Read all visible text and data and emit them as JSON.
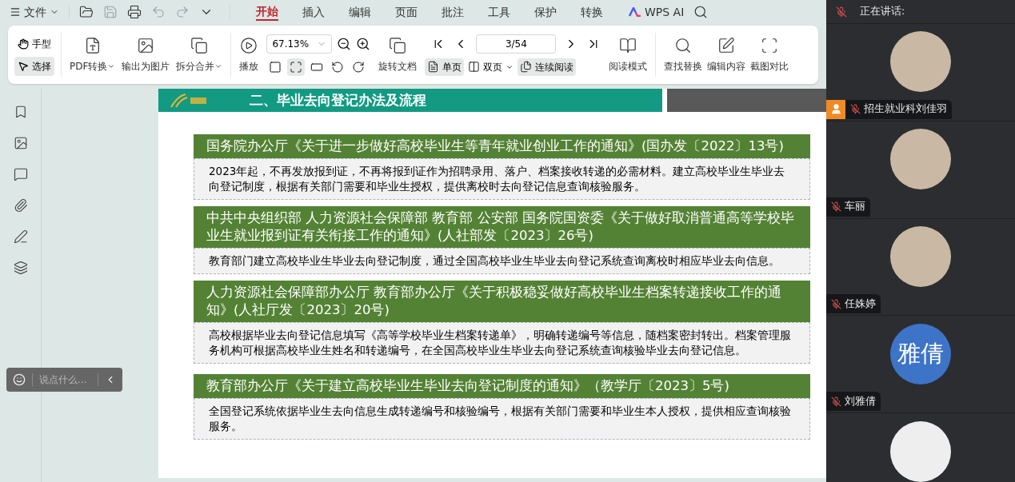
{
  "menu_bar": {
    "file_menu": "文件",
    "tabs": [
      {
        "label": "开始",
        "selected": true
      },
      {
        "label": "插入",
        "selected": false
      },
      {
        "label": "编辑",
        "selected": false
      },
      {
        "label": "页面",
        "selected": false
      },
      {
        "label": "批注",
        "selected": false
      },
      {
        "label": "工具",
        "selected": false
      },
      {
        "label": "保护",
        "selected": false
      },
      {
        "label": "转换",
        "selected": false
      }
    ],
    "ai_label": "WPS AI"
  },
  "ribbon": {
    "cursor_modes": [
      {
        "label": "手型",
        "selected": false
      },
      {
        "label": "选择",
        "selected": true
      }
    ],
    "file_tools": [
      {
        "label": "PDF转换",
        "dropdown": true
      },
      {
        "label": "输出为图片",
        "dropdown": false
      },
      {
        "label": "拆分合并",
        "dropdown": true
      }
    ],
    "play": "播放",
    "zoom": "67.13%",
    "fit_modes": [
      {
        "selected": false
      },
      {
        "selected": true
      },
      {
        "selected": false
      },
      {
        "selected": false
      },
      {
        "selected": false
      }
    ],
    "rotate_doc": "旋转文档",
    "page": "3/54",
    "view_modes": [
      {
        "label": "单页",
        "selected": true,
        "dropdown": false
      },
      {
        "label": "双页",
        "selected": false,
        "dropdown": true
      },
      {
        "label": "连续阅读",
        "selected": true,
        "dropdown": false
      }
    ],
    "read_mode": "阅读模式",
    "tools": [
      "查找替换",
      "编辑内容",
      "截图对比"
    ]
  },
  "chat": {
    "placeholder": "说点什么..."
  },
  "slide": {
    "title": "二、毕业去向登记办法及流程",
    "sections": [
      {
        "heading": "国务院办公厅《关于进一步做好高校毕业生等青年就业创业工作的通知》(国办发〔2022〕13号)",
        "body": "2023年起，不再发放报到证，不再将报到证作为招聘录用、落户、档案接收转递的必需材料。建立高校毕业生毕业去向登记制度，根据有关部门需要和毕业生授权，提供离校时去向登记信息查询核验服务。"
      },
      {
        "heading": "中共中央组织部 人力资源社会保障部 教育部 公安部 国务院国资委《关于做好取消普通高等学校毕业生就业报到证有关衔接工作的通知》(人社部发〔2023〕26号)",
        "body": "教育部门建立高校毕业生毕业去向登记制度，通过全国高校毕业生毕业去向登记系统查询离校时相应毕业去向信息。"
      },
      {
        "heading": "人力资源社会保障部办公厅 教育部办公厅《关于积极稳妥做好高校毕业生档案转递接收工作的通知》(人社厅发〔2023〕20号)",
        "body": "高校根据毕业去向登记信息填写《高等学校毕业生档案转递单》，明确转递编号等信息，随档案密封转出。档案管理服务机构可根据高校毕业生姓名和转递编号，在全国高校毕业生毕业去向登记系统查询核验毕业去向登记信息。"
      },
      {
        "heading": "教育部办公厅《关于建立高校毕业生毕业去向登记制度的通知》（教学厅〔2023〕5号)",
        "body": "全国登记系统依据毕业生去向信息生成转递编号和核验编号，根据有关部门需要和毕业生本人授权，提供相应查询核验服务。"
      }
    ]
  },
  "meeting": {
    "speaking_label": "正在讲话:",
    "participants": [
      {
        "name": "招生就业科刘佳羽",
        "kind": "photo",
        "host": true,
        "muted": true
      },
      {
        "name": "车丽",
        "kind": "photo",
        "host": false,
        "muted": true
      },
      {
        "name": "任姝婷",
        "kind": "photo",
        "host": false,
        "muted": true
      },
      {
        "name": "刘雅倩",
        "kind": "initials",
        "initials": "雅倩",
        "host": false,
        "muted": true
      }
    ]
  }
}
